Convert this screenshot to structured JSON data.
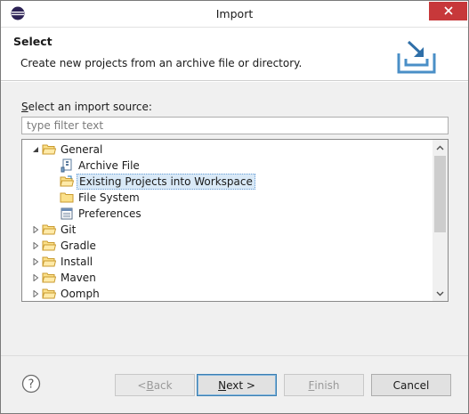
{
  "window": {
    "title": "Import",
    "app_icon": "eclipse-icon",
    "close_icon": "close-icon",
    "accent_close": "#c7383a"
  },
  "banner": {
    "title": "Select",
    "description": "Create new projects from an archive file or directory.",
    "icon": "import-tray-icon"
  },
  "source": {
    "label": "Select an import source:",
    "label_mnemonic": "S",
    "label_rest": "elect an import source:",
    "filter_placeholder": "type filter text",
    "filter_value": ""
  },
  "tree": {
    "items": [
      {
        "label": "General",
        "expanded": true,
        "icon": "folder-open-icon",
        "level": 0
      },
      {
        "label": "Archive File",
        "icon": "archive-file-icon",
        "level": 1
      },
      {
        "label": "Existing Projects into Workspace",
        "icon": "existing-projects-icon",
        "level": 1,
        "selected": true
      },
      {
        "label": "File System",
        "icon": "folder-icon",
        "level": 1
      },
      {
        "label": "Preferences",
        "icon": "preferences-icon",
        "level": 1
      },
      {
        "label": "Git",
        "expanded": false,
        "icon": "folder-icon",
        "level": 0
      },
      {
        "label": "Gradle",
        "expanded": false,
        "icon": "folder-icon",
        "level": 0
      },
      {
        "label": "Install",
        "expanded": false,
        "icon": "folder-icon",
        "level": 0
      },
      {
        "label": "Maven",
        "expanded": false,
        "icon": "folder-icon",
        "level": 0
      },
      {
        "label": "Oomph",
        "expanded": false,
        "icon": "folder-icon",
        "level": 0
      }
    ]
  },
  "footer": {
    "help_icon": "help-icon",
    "back_prefix": "< ",
    "back_mnemonic": "B",
    "back_rest": "ack",
    "next_mnemonic": "N",
    "next_rest": "ext >",
    "finish_mnemonic": "F",
    "finish_rest": "inish",
    "cancel_label": "Cancel"
  }
}
